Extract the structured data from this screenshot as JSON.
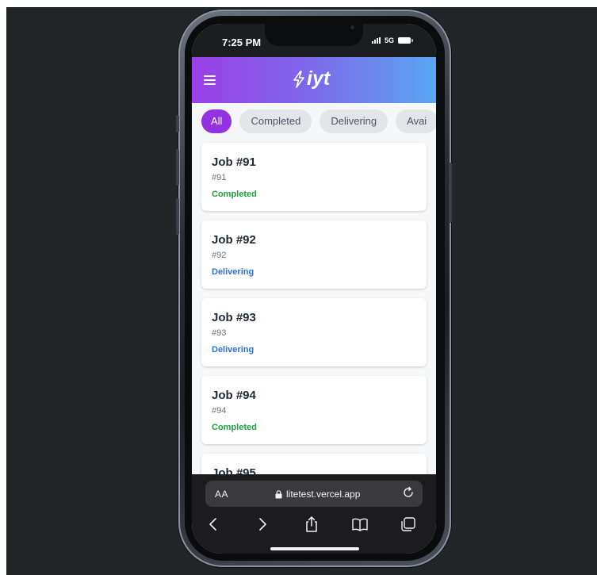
{
  "status_bar": {
    "time": "7:25 PM",
    "network": "5G"
  },
  "app": {
    "logo_text": "iyt",
    "menu_icon": "hamburger-menu-icon",
    "brand_gradient": [
      "#9b3fe6",
      "#5aa6f2"
    ]
  },
  "filters": {
    "items": [
      {
        "label": "All",
        "active": true
      },
      {
        "label": "Completed",
        "active": false
      },
      {
        "label": "Delivering",
        "active": false
      },
      {
        "label": "Avai",
        "active": false
      }
    ],
    "active_color": "#9232e0"
  },
  "jobs": [
    {
      "title": "Job #91",
      "id": "#91",
      "status": "Completed",
      "status_color": "#22a045"
    },
    {
      "title": "Job #92",
      "id": "#92",
      "status": "Delivering",
      "status_color": "#2f6fd6"
    },
    {
      "title": "Job #93",
      "id": "#93",
      "status": "Delivering",
      "status_color": "#2f6fd6"
    },
    {
      "title": "Job #94",
      "id": "#94",
      "status": "Completed",
      "status_color": "#22a045"
    },
    {
      "title": "Job #95"
    }
  ],
  "browser": {
    "text_size_label": "AA",
    "url": "litetest.vercel.app",
    "icons": [
      "lock-icon",
      "reload-icon",
      "back-icon",
      "forward-icon",
      "share-icon",
      "bookmarks-icon",
      "tabs-icon"
    ]
  }
}
